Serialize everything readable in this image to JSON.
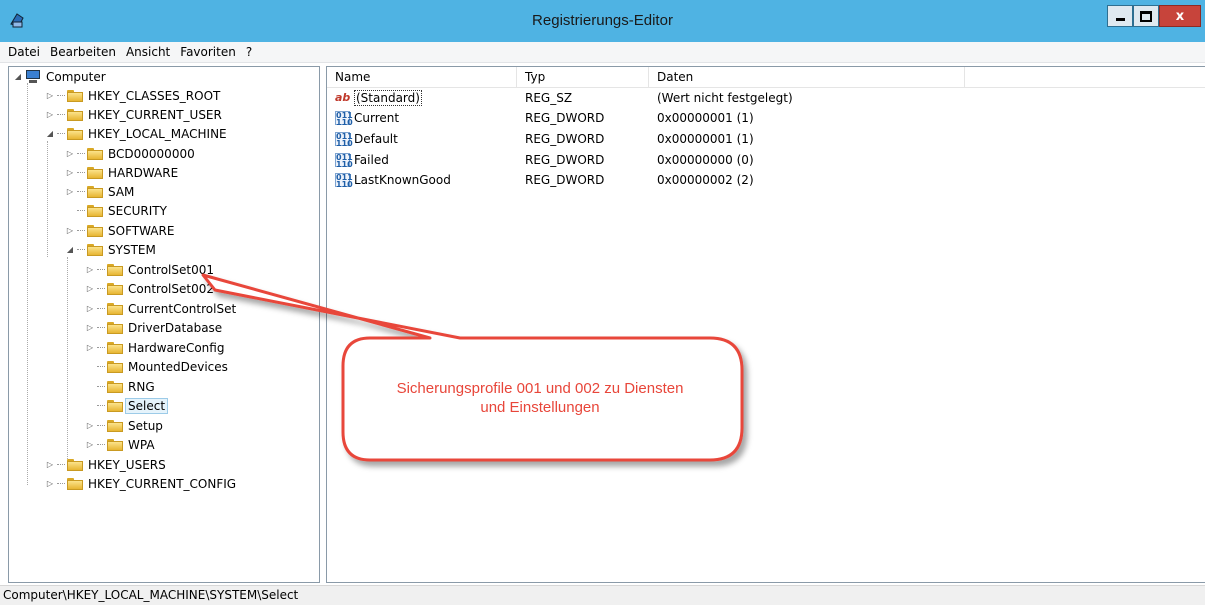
{
  "window": {
    "title": "Registrierungs-Editor",
    "minimize": "_",
    "maximize": "□",
    "close": "x"
  },
  "menu": [
    "Datei",
    "Bearbeiten",
    "Ansicht",
    "Favoriten",
    "?"
  ],
  "tree": {
    "root": "Computer",
    "nodes": [
      "HKEY_CLASSES_ROOT",
      "HKEY_CURRENT_USER",
      "HKEY_LOCAL_MACHINE",
      "BCD00000000",
      "HARDWARE",
      "SAM",
      "SECURITY",
      "SOFTWARE",
      "SYSTEM",
      "ControlSet001",
      "ControlSet002",
      "CurrentControlSet",
      "DriverDatabase",
      "HardwareConfig",
      "MountedDevices",
      "RNG",
      "Select",
      "Setup",
      "WPA",
      "HKEY_USERS",
      "HKEY_CURRENT_CONFIG"
    ]
  },
  "list": {
    "columns": [
      "Name",
      "Typ",
      "Daten"
    ],
    "rows": [
      {
        "name": "(Standard)",
        "type": "REG_SZ",
        "data": "(Wert nicht festgelegt)",
        "icon": "string-value-icon"
      },
      {
        "name": "Current",
        "type": "REG_DWORD",
        "data": "0x00000001 (1)",
        "icon": "dword-value-icon"
      },
      {
        "name": "Default",
        "type": "REG_DWORD",
        "data": "0x00000001 (1)",
        "icon": "dword-value-icon"
      },
      {
        "name": "Failed",
        "type": "REG_DWORD",
        "data": "0x00000000 (0)",
        "icon": "dword-value-icon"
      },
      {
        "name": "LastKnownGood",
        "type": "REG_DWORD",
        "data": "0x00000002 (2)",
        "icon": "dword-value-icon"
      }
    ]
  },
  "annotation": {
    "line1": "Sicherungsprofile 001 und 002 zu Diensten",
    "line2": "und Einstellungen",
    "color": "#e8463a"
  },
  "status": "Computer\\HKEY_LOCAL_MACHINE\\SYSTEM\\Select"
}
